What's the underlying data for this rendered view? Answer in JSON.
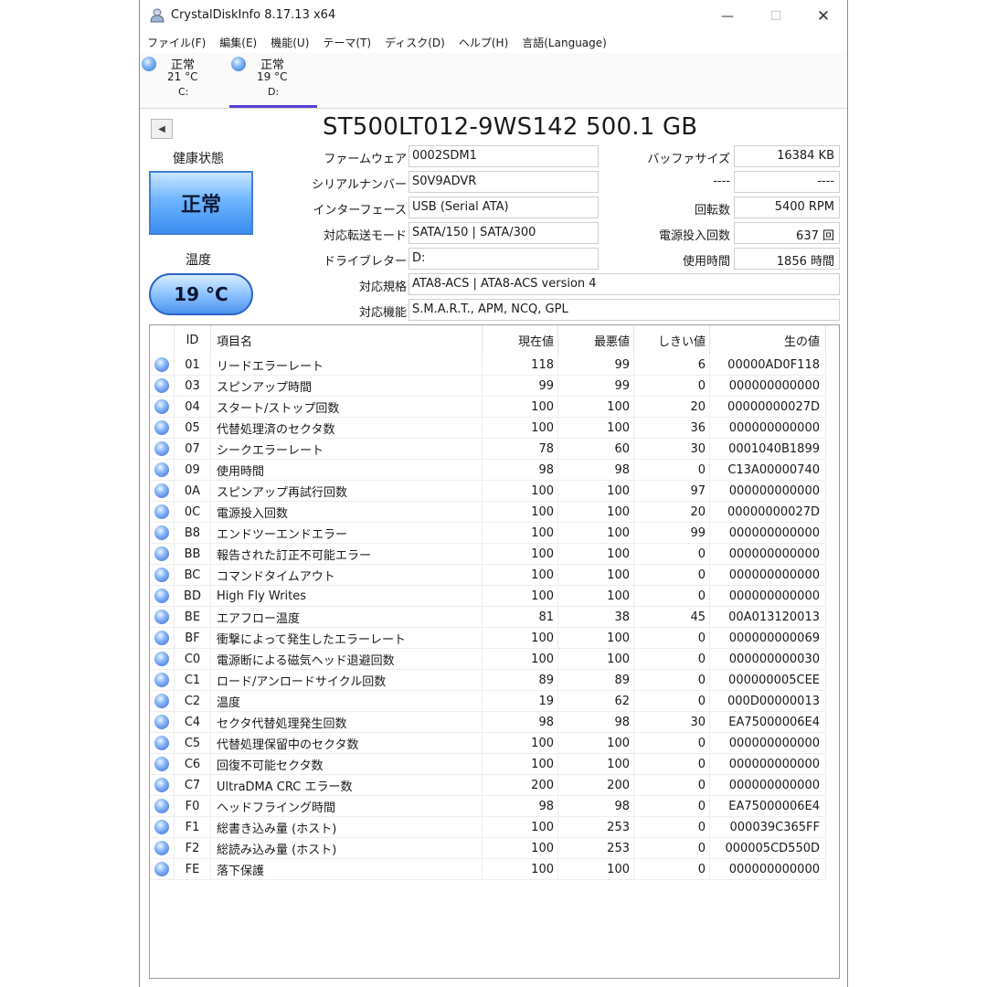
{
  "window": {
    "title": "CrystalDiskInfo 8.17.13 x64"
  },
  "menu": [
    "ファイル(F)",
    "編集(E)",
    "機能(U)",
    "テーマ(T)",
    "ディスク(D)",
    "ヘルプ(H)",
    "言語(Language)"
  ],
  "drives": [
    {
      "status": "正常",
      "temp": "21 °C",
      "letter": "C:"
    },
    {
      "status": "正常",
      "temp": "19 °C",
      "letter": "D:"
    }
  ],
  "disk": {
    "model": "ST500LT012-9WS142 500.1 GB",
    "health_label": "健康状態",
    "health": "正常",
    "temp_label": "温度",
    "temp": "19 °C",
    "firmware_label": "ファームウェア",
    "firmware": "0002SDM1",
    "serial_label": "シリアルナンバー",
    "serial": "S0V9ADVR",
    "interface_label": "インターフェース",
    "interface": "USB (Serial ATA)",
    "transfer_label": "対応転送モード",
    "transfer": "SATA/150 | SATA/300",
    "letter_label": "ドライブレター",
    "letter": "D:",
    "standard_label": "対応規格",
    "standard": "ATA8-ACS | ATA8-ACS version 4",
    "features_label": "対応機能",
    "features": "S.M.A.R.T., APM, NCQ, GPL",
    "buffer_label": "バッファサイズ",
    "buffer": "16384 KB",
    "blank1_label": "----",
    "blank1": "----",
    "rotation_label": "回転数",
    "rotation": "5400 RPM",
    "power_count_label": "電源投入回数",
    "power_count": "637 回",
    "power_hours_label": "使用時間",
    "power_hours": "1856 時間"
  },
  "smart": {
    "headers": {
      "id": "ID",
      "name": "項目名",
      "current": "現在値",
      "worst": "最悪値",
      "threshold": "しきい値",
      "raw": "生の値"
    },
    "rows": [
      {
        "id": "01",
        "name": "リードエラーレート",
        "current": "118",
        "worst": "99",
        "threshold": "6",
        "raw": "00000AD0F118"
      },
      {
        "id": "03",
        "name": "スピンアップ時間",
        "current": "99",
        "worst": "99",
        "threshold": "0",
        "raw": "000000000000"
      },
      {
        "id": "04",
        "name": "スタート/ストップ回数",
        "current": "100",
        "worst": "100",
        "threshold": "20",
        "raw": "00000000027D"
      },
      {
        "id": "05",
        "name": "代替処理済のセクタ数",
        "current": "100",
        "worst": "100",
        "threshold": "36",
        "raw": "000000000000"
      },
      {
        "id": "07",
        "name": "シークエラーレート",
        "current": "78",
        "worst": "60",
        "threshold": "30",
        "raw": "0001040B1899"
      },
      {
        "id": "09",
        "name": "使用時間",
        "current": "98",
        "worst": "98",
        "threshold": "0",
        "raw": "C13A00000740"
      },
      {
        "id": "0A",
        "name": "スピンアップ再試行回数",
        "current": "100",
        "worst": "100",
        "threshold": "97",
        "raw": "000000000000"
      },
      {
        "id": "0C",
        "name": "電源投入回数",
        "current": "100",
        "worst": "100",
        "threshold": "20",
        "raw": "00000000027D"
      },
      {
        "id": "B8",
        "name": "エンドツーエンドエラー",
        "current": "100",
        "worst": "100",
        "threshold": "99",
        "raw": "000000000000"
      },
      {
        "id": "BB",
        "name": "報告された訂正不可能エラー",
        "current": "100",
        "worst": "100",
        "threshold": "0",
        "raw": "000000000000"
      },
      {
        "id": "BC",
        "name": "コマンドタイムアウト",
        "current": "100",
        "worst": "100",
        "threshold": "0",
        "raw": "000000000000"
      },
      {
        "id": "BD",
        "name": "High Fly Writes",
        "current": "100",
        "worst": "100",
        "threshold": "0",
        "raw": "000000000000"
      },
      {
        "id": "BE",
        "name": "エアフロー温度",
        "current": "81",
        "worst": "38",
        "threshold": "45",
        "raw": "00A013120013"
      },
      {
        "id": "BF",
        "name": "衝撃によって発生したエラーレート",
        "current": "100",
        "worst": "100",
        "threshold": "0",
        "raw": "000000000069"
      },
      {
        "id": "C0",
        "name": "電源断による磁気ヘッド退避回数",
        "current": "100",
        "worst": "100",
        "threshold": "0",
        "raw": "000000000030"
      },
      {
        "id": "C1",
        "name": "ロード/アンロードサイクル回数",
        "current": "89",
        "worst": "89",
        "threshold": "0",
        "raw": "000000005CEE"
      },
      {
        "id": "C2",
        "name": "温度",
        "current": "19",
        "worst": "62",
        "threshold": "0",
        "raw": "000D00000013"
      },
      {
        "id": "C4",
        "name": "セクタ代替処理発生回数",
        "current": "98",
        "worst": "98",
        "threshold": "30",
        "raw": "EA75000006E4"
      },
      {
        "id": "C5",
        "name": "代替処理保留中のセクタ数",
        "current": "100",
        "worst": "100",
        "threshold": "0",
        "raw": "000000000000"
      },
      {
        "id": "C6",
        "name": "回復不可能セクタ数",
        "current": "100",
        "worst": "100",
        "threshold": "0",
        "raw": "000000000000"
      },
      {
        "id": "C7",
        "name": "UltraDMA CRC エラー数",
        "current": "200",
        "worst": "200",
        "threshold": "0",
        "raw": "000000000000"
      },
      {
        "id": "F0",
        "name": "ヘッドフライング時間",
        "current": "98",
        "worst": "98",
        "threshold": "0",
        "raw": "EA75000006E4"
      },
      {
        "id": "F1",
        "name": "総書き込み量 (ホスト)",
        "current": "100",
        "worst": "253",
        "threshold": "0",
        "raw": "000039C365FF"
      },
      {
        "id": "F2",
        "name": "総読み込み量 (ホスト)",
        "current": "100",
        "worst": "253",
        "threshold": "0",
        "raw": "000005CD550D"
      },
      {
        "id": "FE",
        "name": "落下保護",
        "current": "100",
        "worst": "100",
        "threshold": "0",
        "raw": "000000000000"
      }
    ]
  }
}
